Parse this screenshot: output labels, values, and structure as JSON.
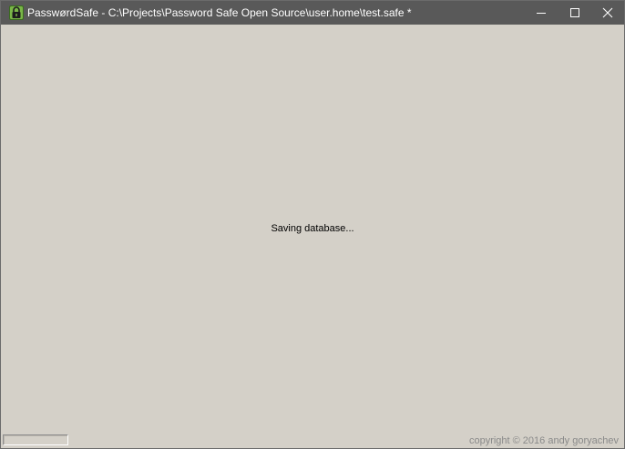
{
  "window": {
    "title": "PasswørdSafe - C:\\Projects\\Password Safe Open Source\\user.home\\test.safe *",
    "controls": {
      "minimize_icon": "minimize-icon",
      "maximize_icon": "maximize-icon",
      "close_icon": "close-icon"
    },
    "titlebar_color": "#595959",
    "icon_color": "#7ab648"
  },
  "main": {
    "status_message": "Saving database...",
    "progress": 0,
    "copyright": "copyright © 2016 andy goryachev"
  },
  "colors": {
    "background": "#d4d0c8",
    "copyright_text": "#8a8a8a"
  }
}
